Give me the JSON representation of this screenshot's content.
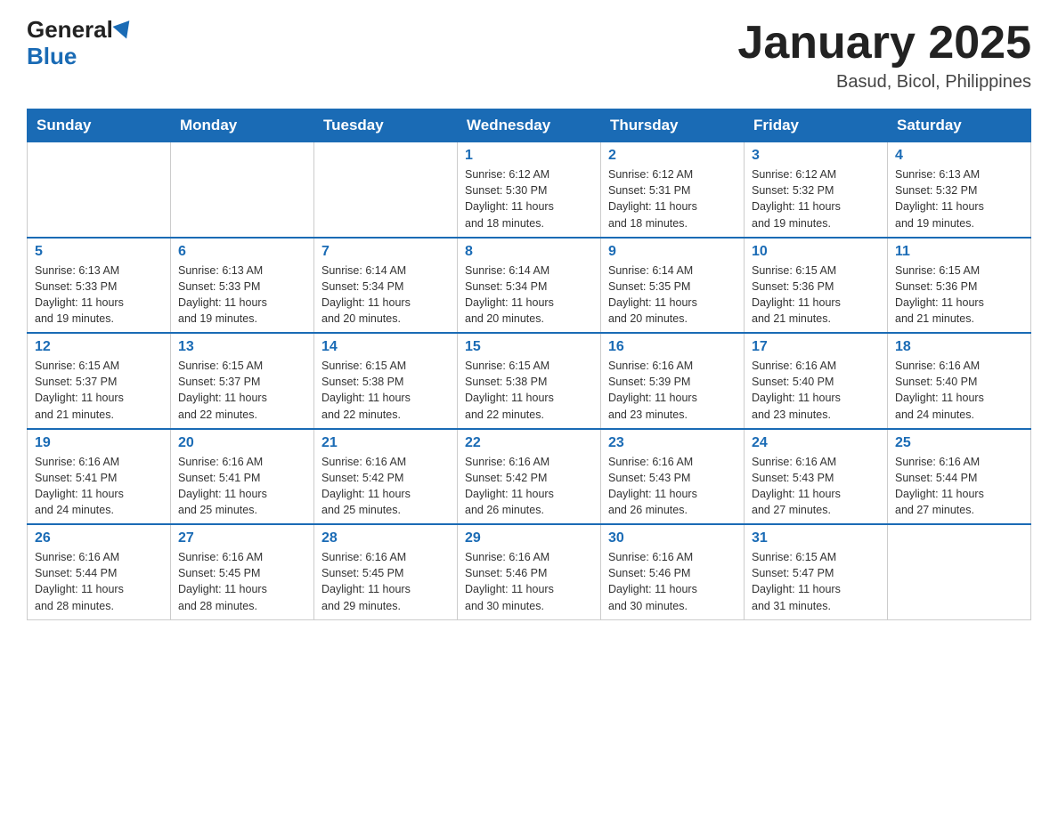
{
  "header": {
    "logo_general": "General",
    "logo_blue": "Blue",
    "title": "January 2025",
    "subtitle": "Basud, Bicol, Philippines"
  },
  "calendar": {
    "days_of_week": [
      "Sunday",
      "Monday",
      "Tuesday",
      "Wednesday",
      "Thursday",
      "Friday",
      "Saturday"
    ],
    "weeks": [
      [
        {
          "day": "",
          "info": ""
        },
        {
          "day": "",
          "info": ""
        },
        {
          "day": "",
          "info": ""
        },
        {
          "day": "1",
          "info": "Sunrise: 6:12 AM\nSunset: 5:30 PM\nDaylight: 11 hours\nand 18 minutes."
        },
        {
          "day": "2",
          "info": "Sunrise: 6:12 AM\nSunset: 5:31 PM\nDaylight: 11 hours\nand 18 minutes."
        },
        {
          "day": "3",
          "info": "Sunrise: 6:12 AM\nSunset: 5:32 PM\nDaylight: 11 hours\nand 19 minutes."
        },
        {
          "day": "4",
          "info": "Sunrise: 6:13 AM\nSunset: 5:32 PM\nDaylight: 11 hours\nand 19 minutes."
        }
      ],
      [
        {
          "day": "5",
          "info": "Sunrise: 6:13 AM\nSunset: 5:33 PM\nDaylight: 11 hours\nand 19 minutes."
        },
        {
          "day": "6",
          "info": "Sunrise: 6:13 AM\nSunset: 5:33 PM\nDaylight: 11 hours\nand 19 minutes."
        },
        {
          "day": "7",
          "info": "Sunrise: 6:14 AM\nSunset: 5:34 PM\nDaylight: 11 hours\nand 20 minutes."
        },
        {
          "day": "8",
          "info": "Sunrise: 6:14 AM\nSunset: 5:34 PM\nDaylight: 11 hours\nand 20 minutes."
        },
        {
          "day": "9",
          "info": "Sunrise: 6:14 AM\nSunset: 5:35 PM\nDaylight: 11 hours\nand 20 minutes."
        },
        {
          "day": "10",
          "info": "Sunrise: 6:15 AM\nSunset: 5:36 PM\nDaylight: 11 hours\nand 21 minutes."
        },
        {
          "day": "11",
          "info": "Sunrise: 6:15 AM\nSunset: 5:36 PM\nDaylight: 11 hours\nand 21 minutes."
        }
      ],
      [
        {
          "day": "12",
          "info": "Sunrise: 6:15 AM\nSunset: 5:37 PM\nDaylight: 11 hours\nand 21 minutes."
        },
        {
          "day": "13",
          "info": "Sunrise: 6:15 AM\nSunset: 5:37 PM\nDaylight: 11 hours\nand 22 minutes."
        },
        {
          "day": "14",
          "info": "Sunrise: 6:15 AM\nSunset: 5:38 PM\nDaylight: 11 hours\nand 22 minutes."
        },
        {
          "day": "15",
          "info": "Sunrise: 6:15 AM\nSunset: 5:38 PM\nDaylight: 11 hours\nand 22 minutes."
        },
        {
          "day": "16",
          "info": "Sunrise: 6:16 AM\nSunset: 5:39 PM\nDaylight: 11 hours\nand 23 minutes."
        },
        {
          "day": "17",
          "info": "Sunrise: 6:16 AM\nSunset: 5:40 PM\nDaylight: 11 hours\nand 23 minutes."
        },
        {
          "day": "18",
          "info": "Sunrise: 6:16 AM\nSunset: 5:40 PM\nDaylight: 11 hours\nand 24 minutes."
        }
      ],
      [
        {
          "day": "19",
          "info": "Sunrise: 6:16 AM\nSunset: 5:41 PM\nDaylight: 11 hours\nand 24 minutes."
        },
        {
          "day": "20",
          "info": "Sunrise: 6:16 AM\nSunset: 5:41 PM\nDaylight: 11 hours\nand 25 minutes."
        },
        {
          "day": "21",
          "info": "Sunrise: 6:16 AM\nSunset: 5:42 PM\nDaylight: 11 hours\nand 25 minutes."
        },
        {
          "day": "22",
          "info": "Sunrise: 6:16 AM\nSunset: 5:42 PM\nDaylight: 11 hours\nand 26 minutes."
        },
        {
          "day": "23",
          "info": "Sunrise: 6:16 AM\nSunset: 5:43 PM\nDaylight: 11 hours\nand 26 minutes."
        },
        {
          "day": "24",
          "info": "Sunrise: 6:16 AM\nSunset: 5:43 PM\nDaylight: 11 hours\nand 27 minutes."
        },
        {
          "day": "25",
          "info": "Sunrise: 6:16 AM\nSunset: 5:44 PM\nDaylight: 11 hours\nand 27 minutes."
        }
      ],
      [
        {
          "day": "26",
          "info": "Sunrise: 6:16 AM\nSunset: 5:44 PM\nDaylight: 11 hours\nand 28 minutes."
        },
        {
          "day": "27",
          "info": "Sunrise: 6:16 AM\nSunset: 5:45 PM\nDaylight: 11 hours\nand 28 minutes."
        },
        {
          "day": "28",
          "info": "Sunrise: 6:16 AM\nSunset: 5:45 PM\nDaylight: 11 hours\nand 29 minutes."
        },
        {
          "day": "29",
          "info": "Sunrise: 6:16 AM\nSunset: 5:46 PM\nDaylight: 11 hours\nand 30 minutes."
        },
        {
          "day": "30",
          "info": "Sunrise: 6:16 AM\nSunset: 5:46 PM\nDaylight: 11 hours\nand 30 minutes."
        },
        {
          "day": "31",
          "info": "Sunrise: 6:15 AM\nSunset: 5:47 PM\nDaylight: 11 hours\nand 31 minutes."
        },
        {
          "day": "",
          "info": ""
        }
      ]
    ]
  }
}
